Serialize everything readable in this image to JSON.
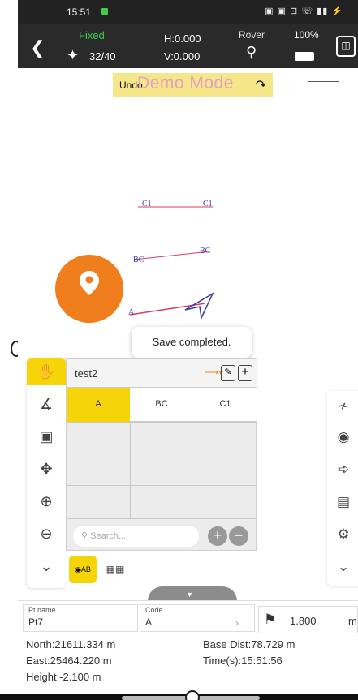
{
  "status": {
    "time": "15:51",
    "icons_right": "▣ ▣ ⊡ ☏ ▮▮ ⚡"
  },
  "gps": {
    "solution": "Fixed",
    "satellites": "32/40",
    "h_precision": "H:0.000",
    "v_precision": "V:0.000",
    "mode": "Rover",
    "battery": "100%"
  },
  "demo": {
    "undo": "Undo",
    "banner": "Demo Mode"
  },
  "map_labels": {
    "c1_left": "C1",
    "c1_right": "C1",
    "bc_left": "BC",
    "bc_right": "BC",
    "a": "A"
  },
  "toast": "Save completed.",
  "panel": {
    "file": "test2",
    "columns": [
      "A",
      "BC",
      "C1"
    ],
    "search_placeholder": "Search..."
  },
  "info": {
    "pt_name_label": "Pt name",
    "pt_name": "Pt7",
    "code_label": "Code",
    "code": "A",
    "antenna_height": "1.800",
    "antenna_unit": "m",
    "north": "North:21611.334 m",
    "east": "East:25464.220 m",
    "height": "Height:-2.100 m",
    "base_dist": "Base Dist:78.729 m",
    "time": "Time(s):15:51:56"
  },
  "icons": {
    "left_tools": [
      "hand-icon",
      "measure-icon",
      "focus-icon",
      "fit-extent-icon",
      "zoom-in-icon",
      "zoom-out-icon",
      "more-down-icon"
    ],
    "right_tools": [
      "route-icon",
      "layers-icon",
      "survey-pole-icon",
      "list-icon",
      "settings-icon",
      "more-down-icon"
    ]
  },
  "colors": {
    "accent": "#f5d50a",
    "location_button": "#f07e1c",
    "fixed": "#3ecf4c"
  }
}
